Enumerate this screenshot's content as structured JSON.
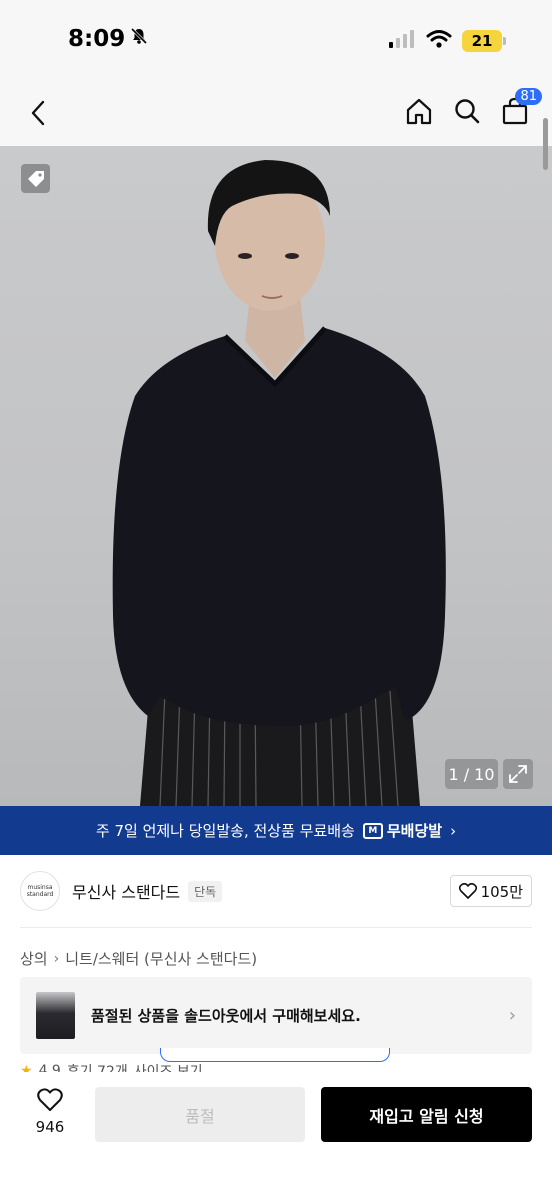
{
  "status_bar": {
    "time": "8:09",
    "battery": "21"
  },
  "nav": {
    "cart_count": "81"
  },
  "hero": {
    "counter": "1 / 10"
  },
  "promo": {
    "text": "주 7일 언제나 당일발송, 전상품 무료배송",
    "logo_glyph": "M",
    "brand": "무배당발",
    "chevron": "›"
  },
  "brand": {
    "logo_line1": "musinsa",
    "logo_line2": "standard",
    "name": "무신사 스탠다드",
    "tag": "단독",
    "likes": "105만"
  },
  "breadcrumb": {
    "items": [
      "상의",
      "니트/스웨터 (무신사 스탠다드)"
    ],
    "separator": "›"
  },
  "soldout_card": {
    "text": "품절된 상품을 솔드아웃에서 구매해보세요.",
    "chevron": "›"
  },
  "review": {
    "rating": "4.9",
    "count": "후기 72개",
    "button": "사이즈 보기"
  },
  "bottom_bar": {
    "like_count": "946",
    "soldout_button": "품절",
    "restock_button": "재입고 알림 신청"
  },
  "colors": {
    "promo_bg": "#123a8f",
    "badge_blue": "#2f6df6",
    "primary_button": "#000000"
  }
}
